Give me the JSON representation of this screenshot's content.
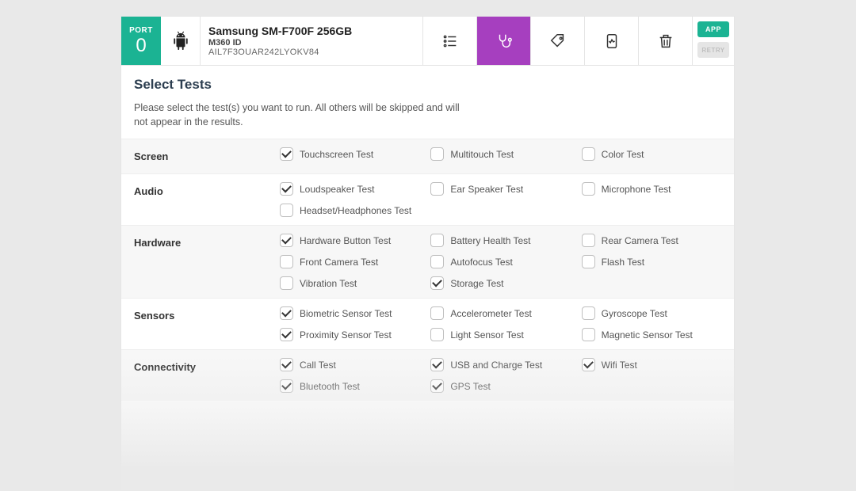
{
  "header": {
    "port_label": "PORT",
    "port_number": "0",
    "device_name": "Samsung SM-F700F 256GB",
    "m360_label": "M360 ID",
    "m360_id": "AIL7F3OUAR242LYOKV84",
    "app_btn": "APP",
    "retry_btn": "RETRY"
  },
  "page": {
    "title": "Select Tests",
    "desc": "Please select the test(s) you want to run. All others will be skipped and will not appear in the results."
  },
  "categories": [
    {
      "label": "Screen",
      "tests": [
        {
          "label": "Touchscreen Test",
          "checked": true
        },
        {
          "label": "Multitouch Test",
          "checked": false
        },
        {
          "label": "Color Test",
          "checked": false
        }
      ]
    },
    {
      "label": "Audio",
      "tests": [
        {
          "label": "Loudspeaker Test",
          "checked": true
        },
        {
          "label": "Ear Speaker Test",
          "checked": false
        },
        {
          "label": "Microphone Test",
          "checked": false
        },
        {
          "label": "Headset/Headphones Test",
          "checked": false
        }
      ]
    },
    {
      "label": "Hardware",
      "tests": [
        {
          "label": "Hardware Button Test",
          "checked": true
        },
        {
          "label": "Battery Health Test",
          "checked": false
        },
        {
          "label": "Rear Camera Test",
          "checked": false
        },
        {
          "label": "Front Camera Test",
          "checked": false
        },
        {
          "label": "Autofocus Test",
          "checked": false
        },
        {
          "label": "Flash Test",
          "checked": false
        },
        {
          "label": "Vibration Test",
          "checked": false
        },
        {
          "label": "Storage Test",
          "checked": true
        }
      ]
    },
    {
      "label": "Sensors",
      "tests": [
        {
          "label": "Biometric Sensor Test",
          "checked": true
        },
        {
          "label": "Accelerometer Test",
          "checked": false
        },
        {
          "label": "Gyroscope Test",
          "checked": false
        },
        {
          "label": "Proximity Sensor Test",
          "checked": true
        },
        {
          "label": "Light Sensor Test",
          "checked": false
        },
        {
          "label": "Magnetic Sensor Test",
          "checked": false
        }
      ]
    },
    {
      "label": "Connectivity",
      "tests": [
        {
          "label": "Call Test",
          "checked": true
        },
        {
          "label": "USB and Charge Test",
          "checked": true
        },
        {
          "label": "Wifi Test",
          "checked": true
        },
        {
          "label": "Bluetooth Test",
          "checked": true
        },
        {
          "label": "GPS Test",
          "checked": true
        }
      ]
    }
  ]
}
